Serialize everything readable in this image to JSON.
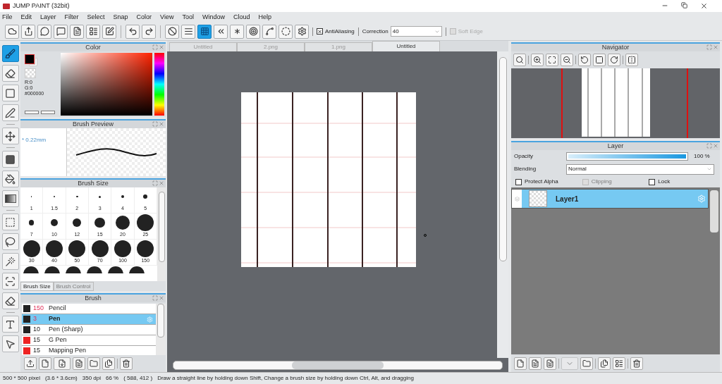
{
  "window": {
    "title": "JUMP PAINT (32bit)"
  },
  "menu": [
    "File",
    "Edit",
    "Layer",
    "Filter",
    "Select",
    "Snap",
    "Color",
    "View",
    "Tool",
    "Window",
    "Cloud",
    "Help"
  ],
  "toolbar": {
    "tools": [
      {
        "kind": "cloud",
        "selected": false
      },
      {
        "kind": "export",
        "selected": false
      },
      {
        "kind": "bubble",
        "selected": false
      },
      {
        "kind": "message",
        "selected": false
      },
      {
        "kind": "page",
        "selected": false
      },
      {
        "kind": "layout",
        "selected": false
      },
      {
        "kind": "edit",
        "selected": false
      },
      {
        "kind": "undo",
        "selected": false
      },
      {
        "kind": "redo",
        "selected": false
      },
      {
        "kind": "none",
        "selected": false
      },
      {
        "kind": "lines",
        "selected": false
      },
      {
        "kind": "grid",
        "selected": true
      },
      {
        "kind": "perspective",
        "selected": false
      },
      {
        "kind": "radial",
        "selected": false
      },
      {
        "kind": "concentric",
        "selected": false
      },
      {
        "kind": "curve",
        "selected": false
      },
      {
        "kind": "circle",
        "selected": false
      },
      {
        "kind": "gear",
        "selected": false
      }
    ],
    "antialiasing": {
      "label": "AntiAliasing",
      "checked": true
    },
    "correction": {
      "label": "Correction",
      "value": "40"
    },
    "soft_edge": {
      "label": "Soft Edge",
      "checked": false,
      "disabled": true
    }
  },
  "tools": [
    {
      "kind": "brush",
      "selected": true
    },
    {
      "kind": "eraser",
      "selected": false
    },
    {
      "kind": "rect",
      "selected": false
    },
    {
      "kind": "pen",
      "selected": false
    },
    {
      "kind": "move",
      "selected": false
    },
    {
      "kind": "fill",
      "selected": false
    },
    {
      "kind": "bucket",
      "selected": false
    },
    {
      "kind": "gradient",
      "selected": false
    },
    {
      "kind": "select",
      "selected": false
    },
    {
      "kind": "lasso",
      "selected": false
    },
    {
      "kind": "wand",
      "selected": false
    },
    {
      "kind": "selpen",
      "selected": false
    },
    {
      "kind": "selerase",
      "selected": false
    },
    {
      "kind": "text",
      "selected": false
    },
    {
      "kind": "pointer",
      "selected": false
    }
  ],
  "color_panel": {
    "title": "Color",
    "values": [
      "R:0",
      "G:0",
      "#000000"
    ]
  },
  "brush_preview": {
    "title": "Brush Preview",
    "size": "* 0.22mm"
  },
  "brush_size": {
    "title": "Brush Size",
    "sizes": [
      "1",
      "1.5",
      "2",
      "3",
      "4",
      "5",
      "7",
      "10",
      "12",
      "15",
      "20",
      "25",
      "30",
      "40",
      "50",
      "70",
      "100",
      "150"
    ],
    "tabs": [
      {
        "label": "Brush Size",
        "selected": true
      },
      {
        "label": "Brush Control",
        "selected": false
      }
    ]
  },
  "brush": {
    "title": "Brush",
    "items": [
      {
        "size": "150",
        "name": "Pencil",
        "color": "#222222",
        "size_marked": true,
        "selected": false
      },
      {
        "size": "3",
        "name": "Pen",
        "color": "#222222",
        "size_marked": true,
        "selected": true
      },
      {
        "size": "10",
        "name": "Pen (Sharp)",
        "color": "#222222",
        "size_marked": false,
        "selected": false
      },
      {
        "size": "15",
        "name": "G Pen",
        "color": "#ee2222",
        "size_marked": false,
        "selected": false
      },
      {
        "size": "15",
        "name": "Mapping Pen",
        "color": "#ee2222",
        "size_marked": false,
        "selected": false
      }
    ]
  },
  "document_tabs": [
    {
      "label": "Untitled",
      "selected": false
    },
    {
      "label": "2.png",
      "selected": false
    },
    {
      "label": "1.png",
      "selected": false
    },
    {
      "label": "Untitled",
      "selected": true
    }
  ],
  "navigator": {
    "title": "Navigator"
  },
  "layer_panel": {
    "title": "Layer",
    "opacity": {
      "label": "Opacity",
      "level": 1,
      "reading": "100 %"
    },
    "blending": {
      "label": "Blending",
      "value": "Normal"
    },
    "options": [
      {
        "label": "Protect Alpha",
        "checked": false,
        "disabled": false
      },
      {
        "label": "Clipping",
        "checked": false,
        "disabled": true
      },
      {
        "label": "Lock",
        "checked": false,
        "disabled": false
      }
    ],
    "layers": [
      {
        "name": "Layer1",
        "selected": true
      }
    ]
  },
  "status_bar": [
    "500 * 500 pixel",
    "(3.6 * 3.6cm)",
    "350 dpi",
    "66 %",
    "( 588, 412 )",
    "Draw a straight line by holding down Shift, Change a brush size by holding down Ctrl, Alt, and dragging"
  ]
}
